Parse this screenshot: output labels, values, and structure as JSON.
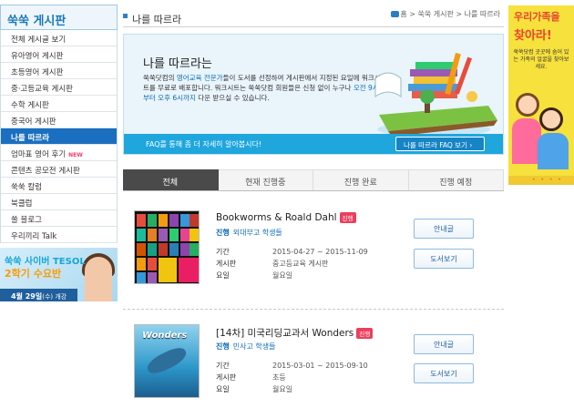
{
  "sidebar": {
    "title": "쑥쑥 게시판",
    "items": [
      {
        "label": "전체 게시글 보기"
      },
      {
        "label": "유아영어 게시판"
      },
      {
        "label": "초등영어 게시판"
      },
      {
        "label": "중·고등교육 게시판"
      },
      {
        "label": "수학 게시판"
      },
      {
        "label": "중국어 게시판"
      },
      {
        "label": "나를 따르라"
      },
      {
        "label": "엄마표 영어 후기",
        "badge": "NEW"
      },
      {
        "label": "콘텐츠 공모전 게시판"
      },
      {
        "label": "쑥쑥 칼럼"
      },
      {
        "label": "북클럽"
      },
      {
        "label": "쏠 블로그"
      },
      {
        "label": "우리끼리 Talk"
      }
    ],
    "active_index": 6
  },
  "left_banner": {
    "line1": "쑥쑥 사이버 TESOL",
    "line2": "2학기 수요반",
    "date": "4월 29일",
    "date_suffix": "(수) 개강"
  },
  "header": {
    "title": "나를 따르라",
    "breadcrumb": {
      "home": "홈",
      "sep": ">",
      "board": "쑥쑥 게시판",
      "current": "나를 따르라"
    }
  },
  "intro": {
    "title": "나를 따르라는",
    "text_1": "쑥쑥닷컴의 ",
    "text_hl1": "영어교육 전문가",
    "text_2": "들이 도서를 선정하여 게시판에서 지정된 요일에 워크시트를 무료로 배포합니다. 워크시트는 쑥쑥닷컴 회원들은 신청 없이 누구나 ",
    "text_hl2": "오전 9시부터 오후 6시까지",
    "text_3": " 다운 받으실 수 있습니다.",
    "faq_text": "FAQ를 통해 좀 더 자세히 알아봅시다!",
    "faq_button": "나를 따르라 FAQ 보기 ›"
  },
  "tabs": [
    {
      "label": "전체"
    },
    {
      "label": "현재 진행중"
    },
    {
      "label": "진행 완료"
    },
    {
      "label": "진행 예정"
    }
  ],
  "tabs_active_index": 0,
  "cards": [
    {
      "title": "Bookworms & Roald Dahl",
      "badge": "진행",
      "target_label": "진행",
      "target": "외대부고 학생들",
      "period_label": "기간",
      "period": "2015-04-27 ~ 2015-11-09",
      "board_label": "게시판",
      "board": "중고등교육 게시판",
      "day_label": "요일",
      "day": "월요일",
      "btn_guide": "안내글",
      "btn_books": "도서보기"
    },
    {
      "title": "[14차] 미국리딩교과서 Wonders",
      "badge": "진행",
      "target_label": "진행",
      "target": "민사고 학생들",
      "period_label": "기간",
      "period": "2015-03-01 ~ 2015-09-10",
      "board_label": "게시판",
      "board": "초등",
      "day_label": "요일",
      "day": "월요일",
      "btn_guide": "안내글",
      "btn_books": "도서보기",
      "cover_text": "Wonders"
    }
  ],
  "right_banner": {
    "line1": "우리가족을",
    "line2": "찾아라!",
    "text": "쑥쑥닷컴 곳곳에 숨어 있는 가족의 얼굴을 찾아보세요.",
    "dots": "• • • •"
  },
  "colors": {
    "accent": "#1b6fc0",
    "intro_bar": "#1ea6dd",
    "badge": "#ec3f5c",
    "right_banner": "#f7e13d"
  }
}
